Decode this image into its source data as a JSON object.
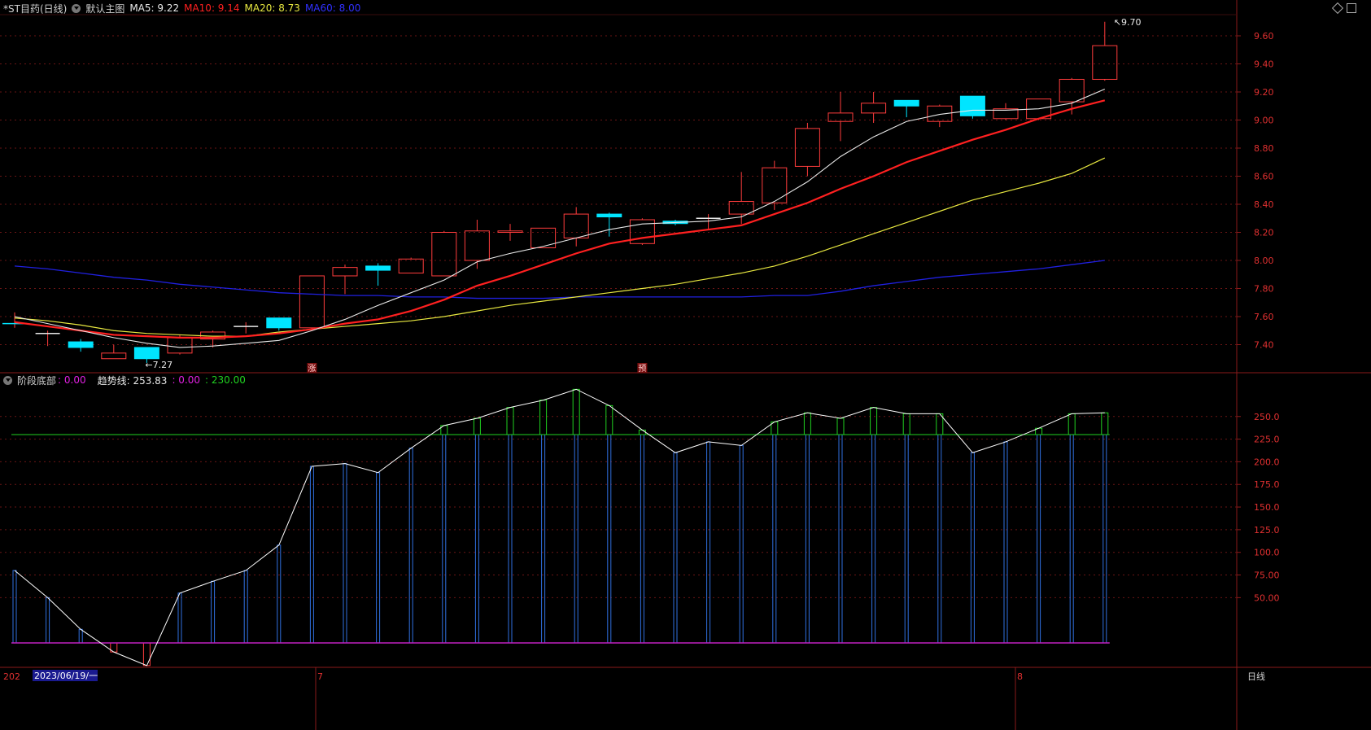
{
  "header": {
    "title": "*ST目药(日线)",
    "main_chart_name": "默认主图",
    "ma5": "MA5: 9.22",
    "ma10": "MA10: 9.14",
    "ma20": "MA20: 8.73",
    "ma60": "MA60: 8.00"
  },
  "indicator": {
    "name": "阶段底部",
    "value1": ": 0.00",
    "trend_label": "趋势线: 253.83",
    "value2": ": 0.00",
    "value3": ": 230.00"
  },
  "colors": {
    "up": "#ff3c3c",
    "down": "#00e5ff",
    "ma5": "#e8e8e8",
    "ma10": "#ff2020",
    "ma20": "#e8e840",
    "ma60": "#2020e0",
    "grid": "#6a1515",
    "axis_text": "#e03030",
    "indicator_bar": "#3070e0",
    "indicator_green": "#20d020",
    "indicator_line": "#ffffff",
    "baseline": "#c020c0"
  },
  "price_axis": {
    "ticks": [
      "9.60",
      "9.40",
      "9.20",
      "9.00",
      "8.80",
      "8.60",
      "8.40",
      "8.20",
      "8.00",
      "7.80",
      "7.60",
      "7.40"
    ],
    "max": 9.7,
    "min": 7.27
  },
  "indicator_axis": {
    "ticks": [
      "250.0",
      "225.0",
      "200.0",
      "175.0",
      "150.0",
      "125.0",
      "100.0",
      "75.00",
      "50.00"
    ]
  },
  "annotations": {
    "high_label": "9.70",
    "low_label": "7.27",
    "marker_zhang": "涨",
    "marker_yu": "预"
  },
  "date_axis": {
    "year_prefix": "202",
    "cursor_date": "2023/06/19/一",
    "month_7": "7",
    "month_8": "8",
    "period": "日线"
  },
  "chart_data": {
    "type": "candlestick",
    "candles": [
      {
        "o": 7.55,
        "c": 7.55,
        "h": 7.63,
        "l": 7.52
      },
      {
        "o": 7.48,
        "c": 7.48,
        "h": 7.5,
        "l": 7.39
      },
      {
        "o": 7.42,
        "c": 7.38,
        "h": 7.44,
        "l": 7.35
      },
      {
        "o": 7.3,
        "c": 7.34,
        "h": 7.4,
        "l": 7.3
      },
      {
        "o": 7.38,
        "c": 7.3,
        "h": 7.38,
        "l": 7.27
      },
      {
        "o": 7.34,
        "c": 7.45,
        "h": 7.47,
        "l": 7.33
      },
      {
        "o": 7.44,
        "c": 7.49,
        "h": 7.5,
        "l": 7.38
      },
      {
        "o": 7.53,
        "c": 7.53,
        "h": 7.56,
        "l": 7.48
      },
      {
        "o": 7.59,
        "c": 7.52,
        "h": 7.59,
        "l": 7.5
      },
      {
        "o": 7.52,
        "c": 7.89,
        "h": 7.89,
        "l": 7.5
      },
      {
        "o": 7.89,
        "c": 7.95,
        "h": 7.97,
        "l": 7.76
      },
      {
        "o": 7.96,
        "c": 7.93,
        "h": 7.98,
        "l": 7.82
      },
      {
        "o": 7.91,
        "c": 8.01,
        "h": 8.02,
        "l": 7.91
      },
      {
        "o": 7.89,
        "c": 8.2,
        "h": 8.21,
        "l": 7.89
      },
      {
        "o": 8.0,
        "c": 8.21,
        "h": 8.29,
        "l": 7.94
      },
      {
        "o": 8.2,
        "c": 8.21,
        "h": 8.26,
        "l": 8.14
      },
      {
        "o": 8.09,
        "c": 8.23,
        "h": 8.23,
        "l": 8.09
      },
      {
        "o": 8.16,
        "c": 8.33,
        "h": 8.38,
        "l": 8.1
      },
      {
        "o": 8.33,
        "c": 8.31,
        "h": 8.34,
        "l": 8.17
      },
      {
        "o": 8.12,
        "c": 8.29,
        "h": 8.3,
        "l": 8.11
      },
      {
        "o": 8.28,
        "c": 8.27,
        "h": 8.29,
        "l": 8.25
      },
      {
        "o": 8.3,
        "c": 8.3,
        "h": 8.33,
        "l": 8.22
      },
      {
        "o": 8.33,
        "c": 8.42,
        "h": 8.63,
        "l": 8.26
      },
      {
        "o": 8.41,
        "c": 8.66,
        "h": 8.71,
        "l": 8.36
      },
      {
        "o": 8.67,
        "c": 8.94,
        "h": 8.98,
        "l": 8.6
      },
      {
        "o": 8.99,
        "c": 9.05,
        "h": 9.2,
        "l": 8.85
      },
      {
        "o": 9.05,
        "c": 9.12,
        "h": 9.2,
        "l": 8.98
      },
      {
        "o": 9.14,
        "c": 9.1,
        "h": 9.14,
        "l": 9.02
      },
      {
        "o": 8.99,
        "c": 9.1,
        "h": 9.11,
        "l": 8.95
      },
      {
        "o": 9.17,
        "c": 9.03,
        "h": 9.17,
        "l": 9.01
      },
      {
        "o": 9.01,
        "c": 9.08,
        "h": 9.12,
        "l": 9.0
      },
      {
        "o": 9.01,
        "c": 9.15,
        "h": 9.15,
        "l": 9.0
      },
      {
        "o": 9.13,
        "c": 9.29,
        "h": 9.3,
        "l": 9.04
      },
      {
        "o": 9.29,
        "c": 9.53,
        "h": 9.7,
        "l": 9.28
      }
    ],
    "ma5": [
      7.6,
      7.55,
      7.5,
      7.45,
      7.41,
      7.38,
      7.39,
      7.41,
      7.43,
      7.5,
      7.58,
      7.68,
      7.77,
      7.86,
      7.99,
      8.05,
      8.1,
      8.16,
      8.22,
      8.26,
      8.27,
      8.28,
      8.31,
      8.42,
      8.56,
      8.74,
      8.88,
      8.99,
      9.04,
      9.07,
      9.07,
      9.08,
      9.12,
      9.22
    ],
    "ma10": [
      7.56,
      7.53,
      7.5,
      7.47,
      7.46,
      7.45,
      7.45,
      7.46,
      7.48,
      7.51,
      7.55,
      7.58,
      7.64,
      7.72,
      7.82,
      7.89,
      7.97,
      8.05,
      8.12,
      8.16,
      8.19,
      8.22,
      8.25,
      8.33,
      8.41,
      8.51,
      8.6,
      8.7,
      8.78,
      8.86,
      8.93,
      9.01,
      9.08,
      9.14
    ],
    "ma20": [
      7.59,
      7.57,
      7.54,
      7.5,
      7.48,
      7.47,
      7.46,
      7.46,
      7.49,
      7.51,
      7.53,
      7.55,
      7.57,
      7.6,
      7.64,
      7.68,
      7.71,
      7.74,
      7.77,
      7.8,
      7.83,
      7.87,
      7.91,
      7.96,
      8.03,
      8.11,
      8.19,
      8.27,
      8.35,
      8.43,
      8.49,
      8.55,
      8.62,
      8.73
    ],
    "ma60": [
      7.96,
      7.94,
      7.91,
      7.88,
      7.86,
      7.83,
      7.81,
      7.79,
      7.77,
      7.76,
      7.75,
      7.75,
      7.74,
      7.74,
      7.73,
      7.73,
      7.73,
      7.74,
      7.74,
      7.74,
      7.74,
      7.74,
      7.74,
      7.75,
      7.75,
      7.78,
      7.82,
      7.85,
      7.88,
      7.9,
      7.92,
      7.94,
      7.97,
      8.0
    ],
    "indicator_trend": [
      80,
      50,
      15,
      -10,
      -25,
      55,
      68,
      80,
      108,
      195,
      198,
      188,
      215,
      240,
      248,
      260,
      268,
      280,
      262,
      235,
      210,
      222,
      218,
      244,
      254,
      248,
      260,
      253,
      253,
      210,
      222,
      237,
      253,
      254
    ],
    "indicator_level": 230,
    "indicator_baseline": 0
  }
}
